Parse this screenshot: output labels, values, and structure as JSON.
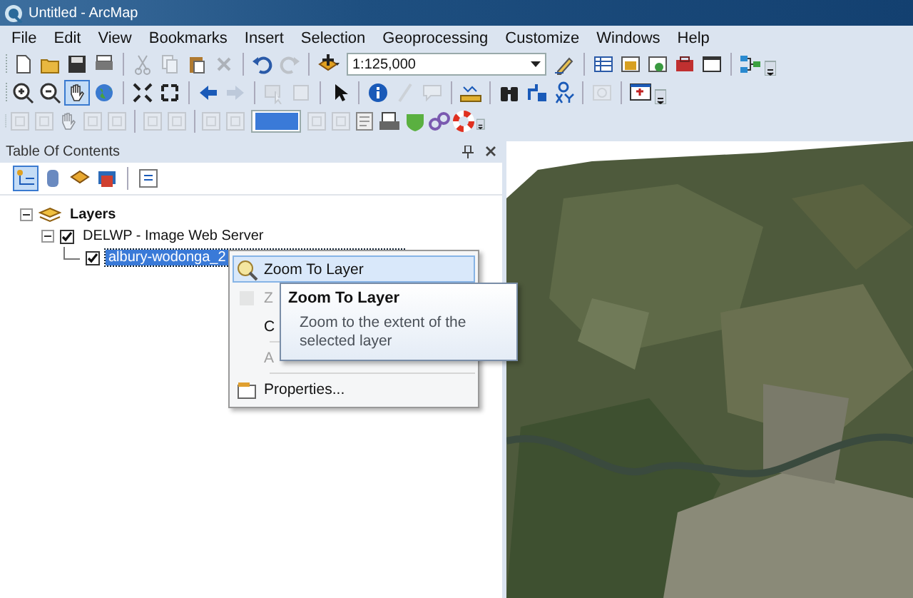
{
  "window": {
    "title": "Untitled - ArcMap"
  },
  "menu": [
    "File",
    "Edit",
    "View",
    "Bookmarks",
    "Insert",
    "Selection",
    "Geoprocessing",
    "Customize",
    "Windows",
    "Help"
  ],
  "toolbars": [
    {
      "items": [
        {
          "kind": "new",
          "selected": false,
          "disabled": false
        },
        {
          "kind": "open",
          "selected": false,
          "disabled": false
        },
        {
          "kind": "save",
          "selected": false,
          "disabled": false
        },
        {
          "kind": "print",
          "selected": false,
          "disabled": false
        },
        {
          "kind": "sep"
        },
        {
          "kind": "cut",
          "selected": false,
          "disabled": true
        },
        {
          "kind": "copy",
          "selected": false,
          "disabled": true
        },
        {
          "kind": "paste",
          "selected": false,
          "disabled": false
        },
        {
          "kind": "delete",
          "selected": false,
          "disabled": true
        },
        {
          "kind": "sep"
        },
        {
          "kind": "undo",
          "selected": false,
          "disabled": false
        },
        {
          "kind": "redo",
          "selected": false,
          "disabled": true
        },
        {
          "kind": "sep"
        },
        {
          "kind": "adddata",
          "selected": false,
          "disabled": false
        },
        {
          "kind": "scale",
          "value": "1:125,000"
        },
        {
          "kind": "editor",
          "selected": false,
          "disabled": false
        },
        {
          "kind": "sep"
        },
        {
          "kind": "table",
          "selected": false,
          "disabled": false
        },
        {
          "kind": "catalog",
          "selected": false,
          "disabled": false
        },
        {
          "kind": "search",
          "selected": false,
          "disabled": false
        },
        {
          "kind": "toolbox",
          "selected": false,
          "disabled": false
        },
        {
          "kind": "window",
          "selected": false,
          "disabled": false
        },
        {
          "kind": "sep"
        },
        {
          "kind": "model",
          "selected": false,
          "disabled": false
        }
      ]
    },
    {
      "items": [
        {
          "kind": "zoomin",
          "selected": false,
          "disabled": false
        },
        {
          "kind": "zoomout",
          "selected": false,
          "disabled": false
        },
        {
          "kind": "pan",
          "selected": true,
          "disabled": false
        },
        {
          "kind": "globe",
          "selected": false,
          "disabled": false
        },
        {
          "kind": "sep"
        },
        {
          "kind": "fixedin",
          "selected": false,
          "disabled": false
        },
        {
          "kind": "fixedout",
          "selected": false,
          "disabled": false
        },
        {
          "kind": "sep"
        },
        {
          "kind": "back",
          "selected": false,
          "disabled": false
        },
        {
          "kind": "forward",
          "selected": false,
          "disabled": true
        },
        {
          "kind": "sep"
        },
        {
          "kind": "selectfeat",
          "selected": false,
          "disabled": true
        },
        {
          "kind": "clear",
          "selected": false,
          "disabled": true
        },
        {
          "kind": "sep"
        },
        {
          "kind": "pointer",
          "selected": false,
          "disabled": false
        },
        {
          "kind": "sep"
        },
        {
          "kind": "identify",
          "selected": false,
          "disabled": false
        },
        {
          "kind": "pencil",
          "selected": false,
          "disabled": true
        },
        {
          "kind": "speech",
          "selected": false,
          "disabled": true
        },
        {
          "kind": "sep"
        },
        {
          "kind": "measure",
          "selected": false,
          "disabled": false
        },
        {
          "kind": "sep"
        },
        {
          "kind": "find",
          "selected": false,
          "disabled": false
        },
        {
          "kind": "route",
          "selected": false,
          "disabled": false
        },
        {
          "kind": "xy",
          "selected": false,
          "disabled": false
        },
        {
          "kind": "sep"
        },
        {
          "kind": "timeslider",
          "selected": false,
          "disabled": true
        },
        {
          "kind": "sep"
        },
        {
          "kind": "viewer",
          "selected": false,
          "disabled": false
        }
      ]
    },
    {
      "items": [
        {
          "kind": "square",
          "selected": false,
          "disabled": true
        },
        {
          "kind": "square",
          "selected": false,
          "disabled": true
        },
        {
          "kind": "pan",
          "selected": false,
          "disabled": true
        },
        {
          "kind": "square",
          "selected": false,
          "disabled": true
        },
        {
          "kind": "square",
          "selected": false,
          "disabled": true
        },
        {
          "kind": "sep"
        },
        {
          "kind": "square",
          "selected": false,
          "disabled": true
        },
        {
          "kind": "square",
          "selected": false,
          "disabled": true
        },
        {
          "kind": "sep"
        },
        {
          "kind": "square",
          "selected": false,
          "disabled": true
        },
        {
          "kind": "square",
          "selected": false,
          "disabled": true
        },
        {
          "kind": "zoomcombo"
        },
        {
          "kind": "square",
          "selected": false,
          "disabled": true
        },
        {
          "kind": "square",
          "selected": false,
          "disabled": true
        },
        {
          "kind": "layoutpage",
          "selected": false,
          "disabled": false
        },
        {
          "kind": "layoutprint",
          "selected": false,
          "disabled": false
        },
        {
          "kind": "gap"
        },
        {
          "kind": "greenshield",
          "selected": false,
          "disabled": false
        },
        {
          "kind": "links",
          "selected": false,
          "disabled": false
        },
        {
          "kind": "lifering",
          "selected": false,
          "disabled": false
        }
      ]
    }
  ],
  "toc": {
    "title": "Table Of Contents",
    "tree": [
      {
        "label": "Layers",
        "expanded": true,
        "children": [
          {
            "label": "DELWP - Image Web Server",
            "checked": true,
            "expanded": true,
            "children": [
              {
                "label": "albury-wodonga_2",
                "checked": true,
                "selected": true
              }
            ]
          }
        ]
      }
    ]
  },
  "context_menu": [
    {
      "label": "Zoom To Layer",
      "selected": true,
      "disabled": false
    },
    {
      "label": "Z",
      "selected": false,
      "disabled": true
    },
    {
      "label": "C",
      "selected": false,
      "disabled": false
    },
    {
      "label": "A",
      "selected": false,
      "disabled": true
    },
    {
      "label": "Properties...",
      "selected": false,
      "disabled": false
    }
  ],
  "tooltip": {
    "title": "Zoom To Layer",
    "text": "Zoom to the extent of the selected layer"
  }
}
